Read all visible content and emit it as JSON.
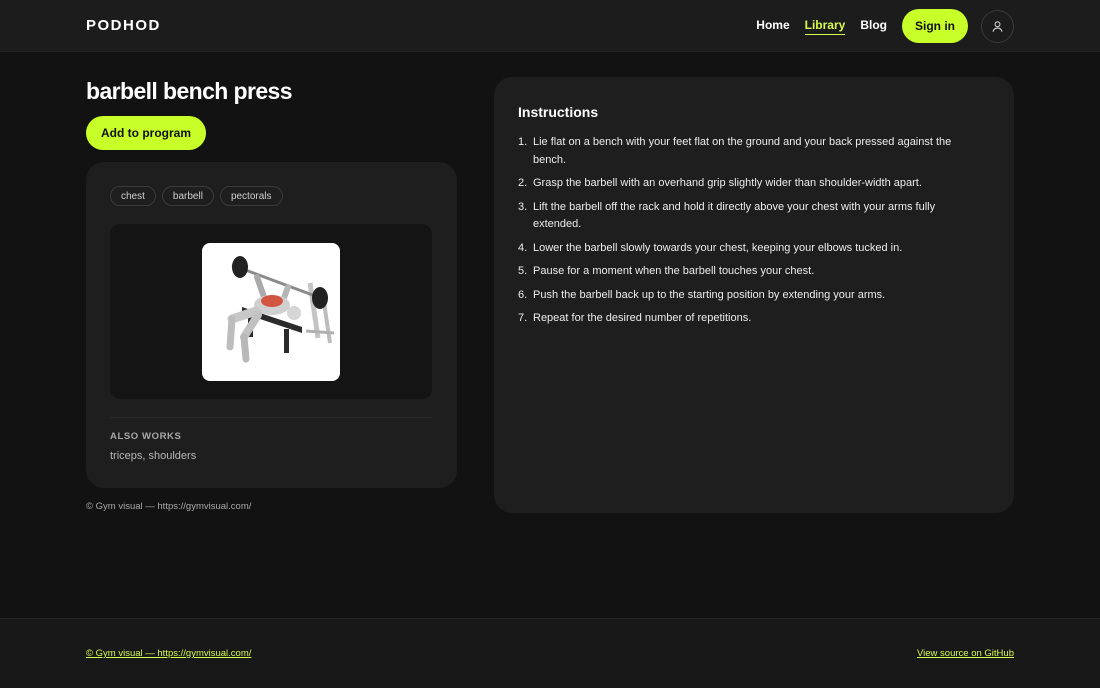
{
  "brand": {
    "logo": "PODHOD"
  },
  "nav": {
    "links": [
      {
        "label": "Home",
        "active": false
      },
      {
        "label": "Library",
        "active": true
      },
      {
        "label": "Blog",
        "active": false
      }
    ],
    "signin_label": "Sign in",
    "avatar_icon": "user-icon"
  },
  "exercise": {
    "title": "barbell bench press",
    "add_label": "Add to program",
    "tags": [
      "chest",
      "barbell",
      "pectorals"
    ],
    "image_alt": "barbell bench press illustration",
    "also_works_label": "ALSO WORKS",
    "also_works_value": "triceps, shoulders",
    "credit": "© Gym visual — https://gymvisual.com/"
  },
  "instructions": {
    "title": "Instructions",
    "steps": [
      "Lie flat on a bench with your feet flat on the ground and your back pressed against the bench.",
      "Grasp the barbell with an overhand grip slightly wider than shoulder-width apart.",
      "Lift the barbell off the rack and hold it directly above your chest with your arms fully extended.",
      "Lower the barbell slowly towards your chest, keeping your elbows tucked in.",
      "Pause for a moment when the barbell touches your chest.",
      "Push the barbell back up to the starting position by extending your arms.",
      "Repeat for the desired number of repetitions."
    ]
  },
  "footer": {
    "credit": "© Gym visual — https://gymvisual.com/",
    "source_label": "View source on GitHub"
  },
  "colors": {
    "accent": "#c8ff29",
    "background": "#121212",
    "card": "#1e1e1e"
  }
}
